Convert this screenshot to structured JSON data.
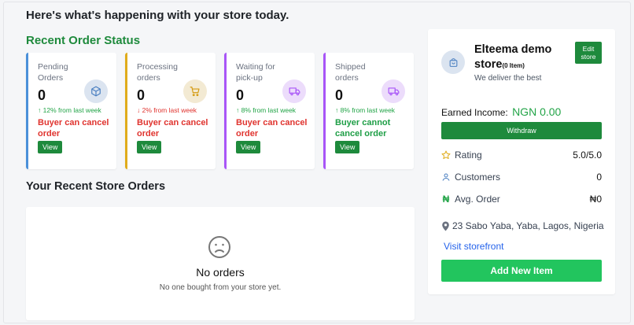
{
  "header": {
    "greeting": "Here's what's happening with your store today."
  },
  "order_status": {
    "title": "Recent Order Status",
    "cards": [
      {
        "label": "Pending Orders",
        "value": "0",
        "trend": "↑ 12% from last week",
        "trend_dir": "up",
        "note": "Buyer can cancel order",
        "note_color": "red",
        "icon": "package-icon",
        "view_label": "View"
      },
      {
        "label": "Processing orders",
        "value": "0",
        "trend": "↓ 2% from last week",
        "trend_dir": "down",
        "note": "Buyer can cancel order",
        "note_color": "red",
        "icon": "cart-icon",
        "view_label": "View"
      },
      {
        "label": "Waiting for pick-up",
        "value": "0",
        "trend": "↑ 8% from last week",
        "trend_dir": "up",
        "note": "Buyer can cancel order",
        "note_color": "red",
        "icon": "truck-icon",
        "view_label": "View"
      },
      {
        "label": "Shipped orders",
        "value": "0",
        "trend": "↑ 8% from last week",
        "trend_dir": "up",
        "note": "Buyer cannot cancel order",
        "note_color": "green",
        "icon": "truck-icon",
        "view_label": "View"
      }
    ]
  },
  "recent_orders": {
    "title": "Your Recent Store Orders",
    "empty_title": "No orders",
    "empty_subtitle": "No one bought from your store yet.",
    "empty_icon": "sad-face-icon"
  },
  "store": {
    "name": "Elteema demo store",
    "item_count": "(0 Item)",
    "tagline": "We deliver the best",
    "edit_label": "Edit store",
    "income_label": "Earned Income:",
    "income_value": "NGN 0.00",
    "withdraw_label": "Withdraw",
    "rating_label": "Rating",
    "rating_value": "5.0/5.0",
    "customers_label": "Customers",
    "customers_value": "0",
    "avg_order_label": "Avg. Order",
    "avg_order_value": "₦0",
    "address": "23 Sabo Yaba, Yaba, Lagos, Nigeria",
    "visit_label": "Visit storefront",
    "add_item_label": "Add New Item"
  },
  "colors": {
    "primary_green": "#1e8a3c",
    "bright_green": "#22c55e",
    "red": "#e0342f",
    "link_blue": "#2563eb"
  }
}
